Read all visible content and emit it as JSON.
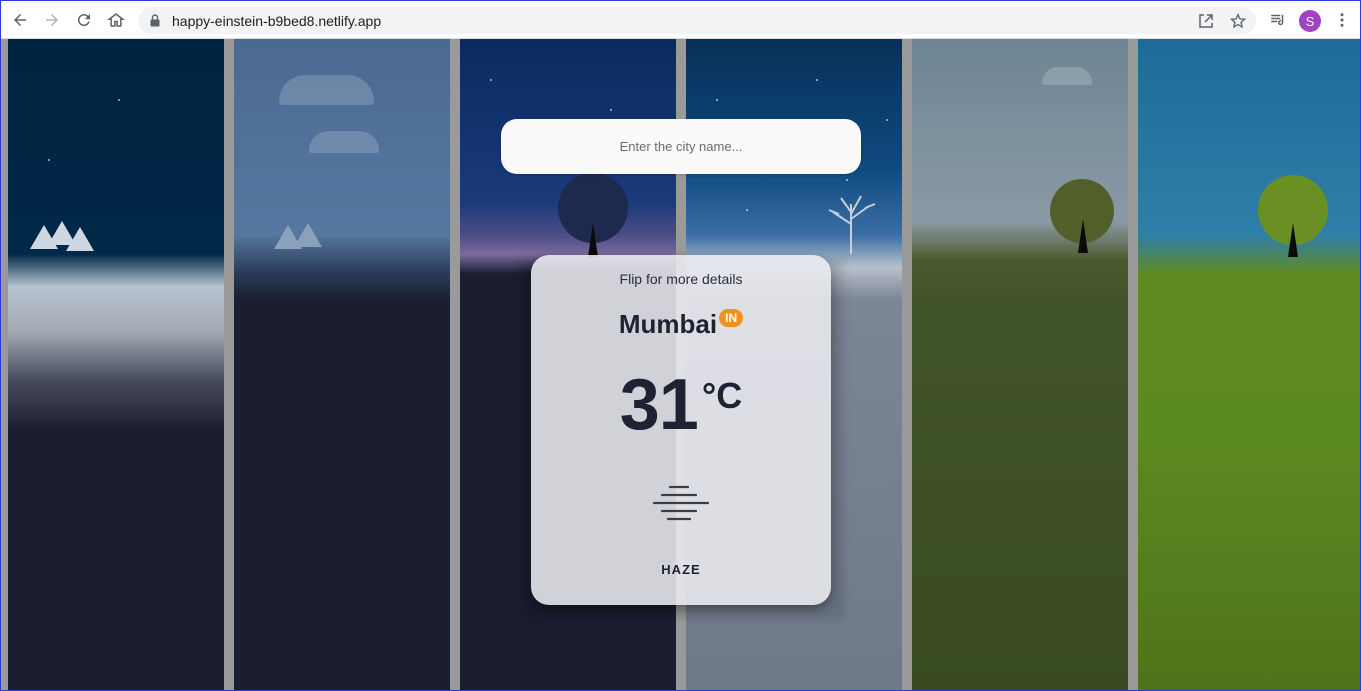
{
  "browser": {
    "url": "happy-einstein-b9bed8.netlify.app",
    "avatar_initial": "S",
    "icons": [
      "back-icon",
      "forward-icon",
      "reload-icon",
      "home-icon",
      "lock-icon",
      "open-external-icon",
      "star-icon",
      "media-queue-icon",
      "more-vert-icon"
    ]
  },
  "search": {
    "placeholder": "Enter the city name..."
  },
  "card": {
    "flip_hint": "Flip for more details",
    "city": "Mumbai",
    "country": "IN",
    "temperature": "31",
    "unit": "°C",
    "condition_icon": "haze-icon",
    "condition": "HAZE"
  },
  "colors": {
    "accent_badge": "#f2921d",
    "card_text": "#1e2233",
    "avatar": "#a142c4"
  }
}
